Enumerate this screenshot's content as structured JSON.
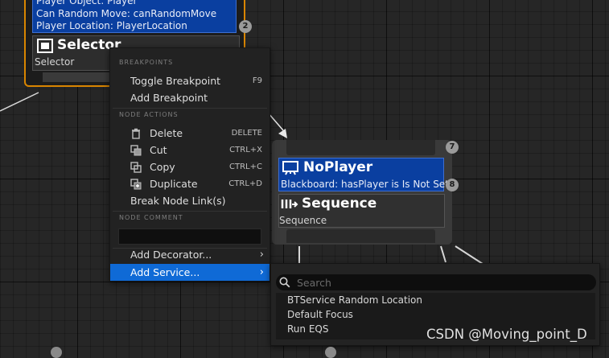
{
  "selector_node": {
    "blackboard_lines": [
      "Player Object: Player",
      "Can Random Move: canRandomMove",
      "Player Location: PlayerLocation"
    ],
    "badge": "2",
    "title": "Selector",
    "subtitle": "Selector"
  },
  "noplayer_node": {
    "top_badge": "7",
    "decorator_title": "NoPlayer",
    "decorator_desc": "Blackboard: hasPlayer is Is Not Set",
    "decorator_badge": "8",
    "composite_title": "Sequence",
    "composite_subtitle": "Sequence"
  },
  "context_menu": {
    "breakpoints_header": "BREAKPOINTS",
    "toggle_breakpoint": {
      "label": "Toggle Breakpoint",
      "shortcut": "F9"
    },
    "add_breakpoint": {
      "label": "Add Breakpoint"
    },
    "node_actions_header": "NODE ACTIONS",
    "delete": {
      "label": "Delete",
      "shortcut": "DELETE"
    },
    "cut": {
      "label": "Cut",
      "shortcut": "CTRL+X"
    },
    "copy": {
      "label": "Copy",
      "shortcut": "CTRL+C"
    },
    "duplicate": {
      "label": "Duplicate",
      "shortcut": "CTRL+D"
    },
    "break_links": {
      "label": "Break Node Link(s)"
    },
    "node_comment_header": "NODE COMMENT",
    "node_comment_value": "",
    "add_decorator": {
      "label": "Add Decorator..."
    },
    "add_service": {
      "label": "Add Service..."
    }
  },
  "service_submenu": {
    "search_placeholder": "Search",
    "items": [
      "BTService Random Location",
      "Default Focus",
      "Run EQS"
    ]
  },
  "watermark": "CSDN @Moving_point_D",
  "colors": {
    "selected_node_border": "#d98500",
    "decorator_blue": "#0a3fa0",
    "menu_highlight": "#0f6ad6",
    "graph_background": "#262626"
  }
}
